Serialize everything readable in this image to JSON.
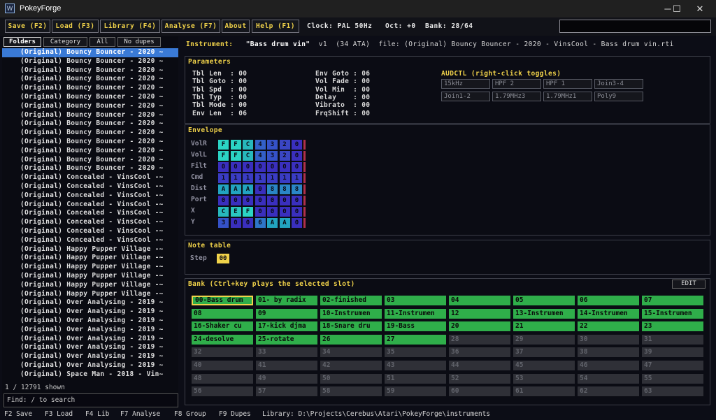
{
  "window": {
    "title": "PokeyForge",
    "icon": "app-logo-icon",
    "controls": [
      "─",
      "☐",
      "✕"
    ]
  },
  "menu": {
    "buttons": [
      "Save (F2)",
      "Load (F3)",
      "Library (F4)",
      "Analyse (F7)",
      "About",
      "Help (F1)"
    ],
    "clock": "Clock: PAL 50Hz",
    "oct": "Oct: +0",
    "bank": "Bank: 28/64",
    "command_value": ""
  },
  "left_panel": {
    "tabs": [
      "Folders",
      "Category",
      "All",
      "No dupes"
    ],
    "items": [
      "(Original) Bouncy Bouncer - 2020 ~",
      "(Original) Bouncy Bouncer - 2020 ~",
      "(Original) Bouncy Bouncer - 2020 ~",
      "(Original) Bouncy Bouncer - 2020 ~",
      "(Original) Bouncy Bouncer - 2020 ~",
      "(Original) Bouncy Bouncer - 2020 ~",
      "(Original) Bouncy Bouncer - 2020 ~",
      "(Original) Bouncy Bouncer - 2020 ~",
      "(Original) Bouncy Bouncer - 2020 ~",
      "(Original) Bouncy Bouncer - 2020 ~",
      "(Original) Bouncy Bouncer - 2020 ~",
      "(Original) Bouncy Bouncer - 2020 ~",
      "(Original) Bouncy Bouncer - 2020 ~",
      "(Original) Bouncy Bouncer - 2020 ~",
      "(Original) Concealed - VinsCool -~",
      "(Original) Concealed - VinsCool -~",
      "(Original) Concealed - VinsCool -~",
      "(Original) Concealed - VinsCool -~",
      "(Original) Concealed - VinsCool -~",
      "(Original) Concealed - VinsCool -~",
      "(Original) Concealed - VinsCool -~",
      "(Original) Concealed - VinsCool -~",
      "(Original) Happy Pupper Village -~",
      "(Original) Happy Pupper Village -~",
      "(Original) Happy Pupper Village -~",
      "(Original) Happy Pupper Village -~",
      "(Original) Happy Pupper Village -~",
      "(Original) Happy Pupper Village -~",
      "(Original) Over Analysing - 2019 ~",
      "(Original) Over Analysing - 2019 ~",
      "(Original) Over Analysing - 2019 ~",
      "(Original) Over Analysing - 2019 ~",
      "(Original) Over Analysing - 2019 ~",
      "(Original) Over Analysing - 2019 ~",
      "(Original) Over Analysing - 2019 ~",
      "(Original) Over Analysing - 2019 ~",
      "(Original) Space Man - 2018 - Vin~"
    ],
    "count": "1 / 12791 shown",
    "find_placeholder": "Find: / to search"
  },
  "instrument": {
    "label": "Instrument:",
    "name": "\"Bass drum vin\"",
    "version": "v1",
    "size": "(34 ATA)",
    "file": "file: (Original) Bouncy Bouncer - 2020 - VinsCool - Bass drum vin.rti"
  },
  "parameters": {
    "title": "Parameters",
    "left": [
      "Tbl Len  : 00",
      "Tbl Goto : 00",
      "Tbl Spd  : 00",
      "Tbl Typ  : 00",
      "Tbl Mode : 00",
      "Env Len  : 06"
    ],
    "right": [
      "Env Goto : 06",
      "Vol Fade : 00",
      "Vol Min  : 00",
      "Delay    : 00",
      "Vibrato  : 00",
      "FrqShift : 00"
    ],
    "audctl_title": "AUDCTL (right-click toggles)",
    "audctl": [
      "15kHz",
      "HPF 2",
      "HPF 1",
      "Join3-4",
      "Join1-2",
      "1.79MHz3",
      "1.79MHz1",
      "Poly9"
    ]
  },
  "envelope": {
    "title": "Envelope",
    "rows": [
      {
        "label": "VolR",
        "cells": [
          "F",
          "F",
          "C",
          "4",
          "3",
          "2",
          "0"
        ]
      },
      {
        "label": "VolL",
        "cells": [
          "F",
          "F",
          "C",
          "4",
          "3",
          "2",
          "0"
        ]
      },
      {
        "label": "Filt",
        "cells": [
          "0",
          "0",
          "0",
          "0",
          "0",
          "0",
          "0"
        ]
      },
      {
        "label": "Cmd",
        "cells": [
          "1",
          "1",
          "1",
          "1",
          "1",
          "1",
          "1"
        ]
      },
      {
        "label": "Dist",
        "cells": [
          "A",
          "A",
          "A",
          "0",
          "8",
          "8",
          "8"
        ]
      },
      {
        "label": "Port",
        "cells": [
          "0",
          "0",
          "0",
          "0",
          "0",
          "0",
          "0"
        ]
      },
      {
        "label": "X",
        "cells": [
          "C",
          "E",
          "F",
          "0",
          "0",
          "0",
          "0"
        ]
      },
      {
        "label": "Y",
        "cells": [
          "3",
          "0",
          "0",
          "6",
          "A",
          "A",
          "0"
        ]
      }
    ],
    "colors": {
      "F": "#2bd4c4",
      "E": "#2ac6c0",
      "C": "#27b8bc",
      "A": "#22a4c0",
      "8": "#2a86c6",
      "6": "#2e76c8",
      "4": "#3360c8",
      "3": "#3552c8",
      "2": "#3a46c4",
      "1": "#3a3cc4",
      "0": "#3a2fbe"
    }
  },
  "note_table": {
    "title": "Note table",
    "step_label": "Step",
    "step_value": "00"
  },
  "bank": {
    "title": "Bank (Ctrl+key plays the selected slot)",
    "edit_label": "EDIT",
    "slots": [
      "00-Bass drum",
      "01- by radix",
      "02-finished",
      "03",
      "04",
      "05",
      "06",
      "07",
      "08",
      "09",
      "10-Instrumen",
      "11-Instrumen",
      "12",
      "13-Instrumen",
      "14-Instrumen",
      "15-Instrumen",
      "16-Shaker cu",
      "17-kick djma",
      "18-Snare dru",
      "19-Bass",
      "20",
      "21",
      "22",
      "23",
      "24-desolve",
      "25-rotate",
      "26",
      "27",
      "28",
      "29",
      "30",
      "31",
      "32",
      "33",
      "34",
      "35",
      "36",
      "37",
      "38",
      "39",
      "40",
      "41",
      "42",
      "43",
      "44",
      "45",
      "46",
      "47",
      "48",
      "49",
      "50",
      "51",
      "52",
      "53",
      "54",
      "55",
      "56",
      "57",
      "58",
      "59",
      "60",
      "61",
      "62",
      "63"
    ],
    "filled_count": 28
  },
  "status": {
    "keys": [
      "F2 Save",
      "F3 Load",
      "F4 Lib",
      "F7 Analyse",
      "F8 Group",
      "F9 Dupes"
    ],
    "library": "Library: D:\\Projects\\Cerebus\\Atari\\PokeyForge\\instruments"
  }
}
